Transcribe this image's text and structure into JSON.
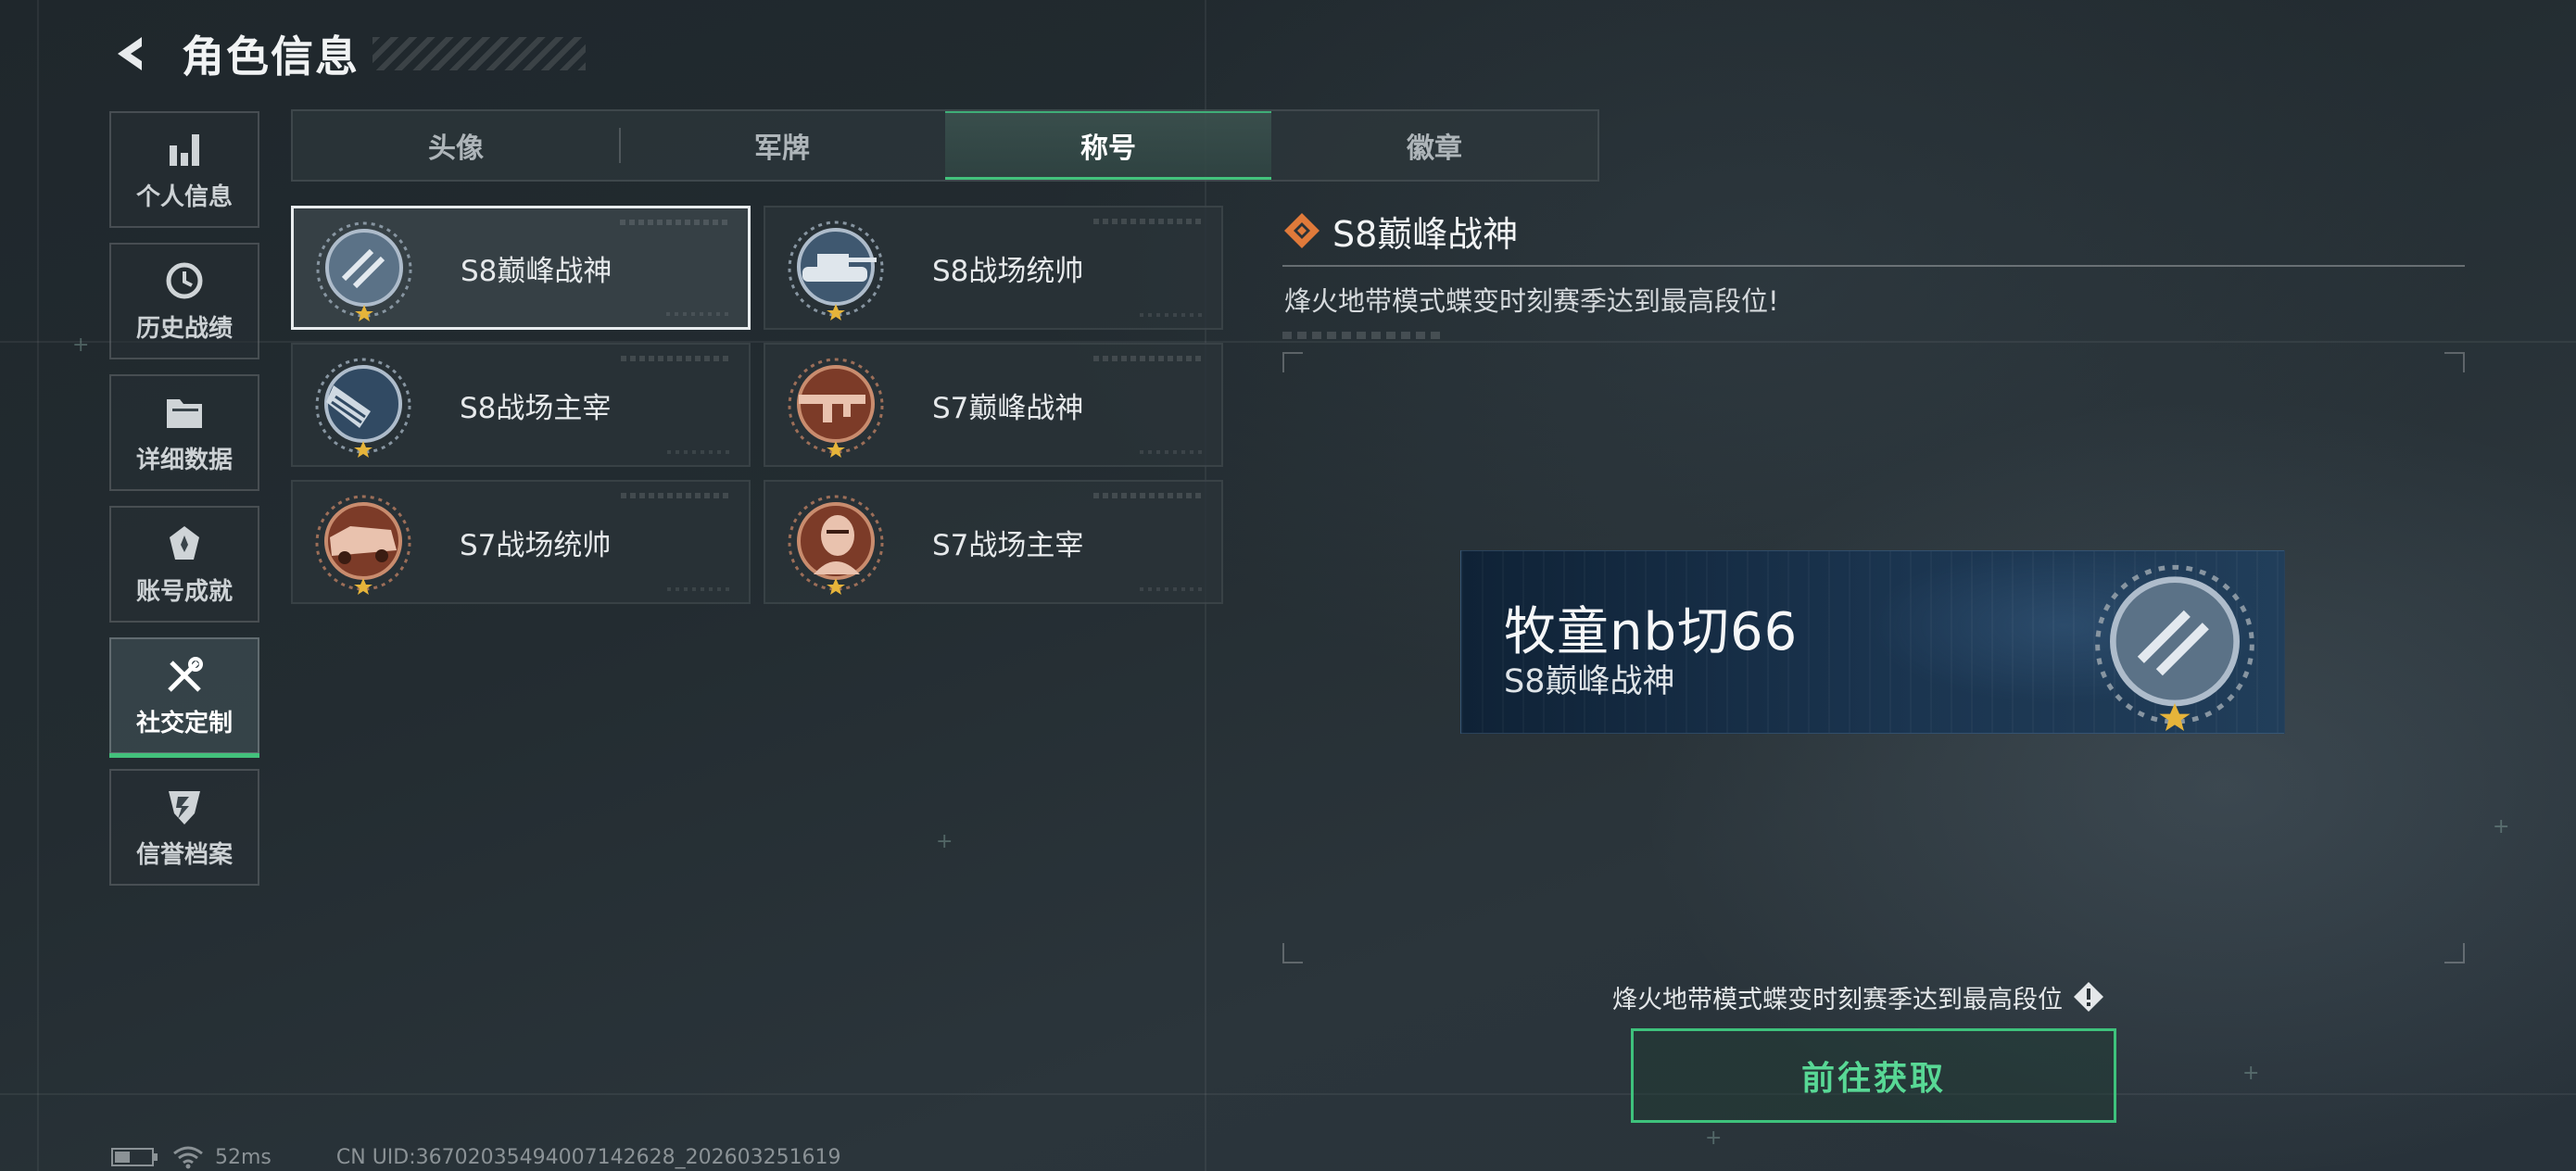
{
  "header": {
    "title": "角色信息"
  },
  "sidebar": {
    "items": [
      {
        "label": "个人信息",
        "icon": "bar-chart-icon",
        "active": false
      },
      {
        "label": "历史战绩",
        "icon": "history-clock-icon",
        "active": false
      },
      {
        "label": "详细数据",
        "icon": "folder-icon",
        "active": false
      },
      {
        "label": "账号成就",
        "icon": "achievement-medal-icon",
        "active": false
      },
      {
        "label": "社交定制",
        "icon": "wrench-screwdriver-icon",
        "active": true
      },
      {
        "label": "信誉档案",
        "icon": "shield-emblem-icon",
        "active": false
      }
    ]
  },
  "tabs": [
    {
      "label": "头像",
      "active": false
    },
    {
      "label": "军牌",
      "active": false
    },
    {
      "label": "称号",
      "active": true
    },
    {
      "label": "徽章",
      "active": false
    }
  ],
  "titles": [
    {
      "name": "S8巅峰战神",
      "badge": "peak-warrior-s8-badge",
      "selected": true
    },
    {
      "name": "S8战场统帅",
      "badge": "tank-s8-badge",
      "selected": false
    },
    {
      "name": "S8战场主宰",
      "badge": "building-s8-badge",
      "selected": false
    },
    {
      "name": "S7巅峰战神",
      "badge": "rifle-s7-badge",
      "selected": false
    },
    {
      "name": "S7战场统帅",
      "badge": "armored-car-s7-badge",
      "selected": false
    },
    {
      "name": "S7战场主宰",
      "badge": "soldier-s7-badge",
      "selected": false
    }
  ],
  "detail": {
    "title": "S8巅峰战神",
    "description": "烽火地带模式蝶变时刻赛季达到最高段位!"
  },
  "nameplate": {
    "player_name": "牧童nb切66",
    "title": "S8巅峰战神"
  },
  "requirement": {
    "text": "烽火地带模式蝶变时刻赛季达到最高段位"
  },
  "action": {
    "label": "前往获取"
  },
  "status": {
    "ping": "52ms",
    "uid": "CN UID:36702035494007142628_202603251619"
  },
  "colors": {
    "accent_green": "#43c27c",
    "badge_steel": "#5b7287",
    "badge_bronze": "#a4563a",
    "detail_orange": "#e07a3a"
  }
}
